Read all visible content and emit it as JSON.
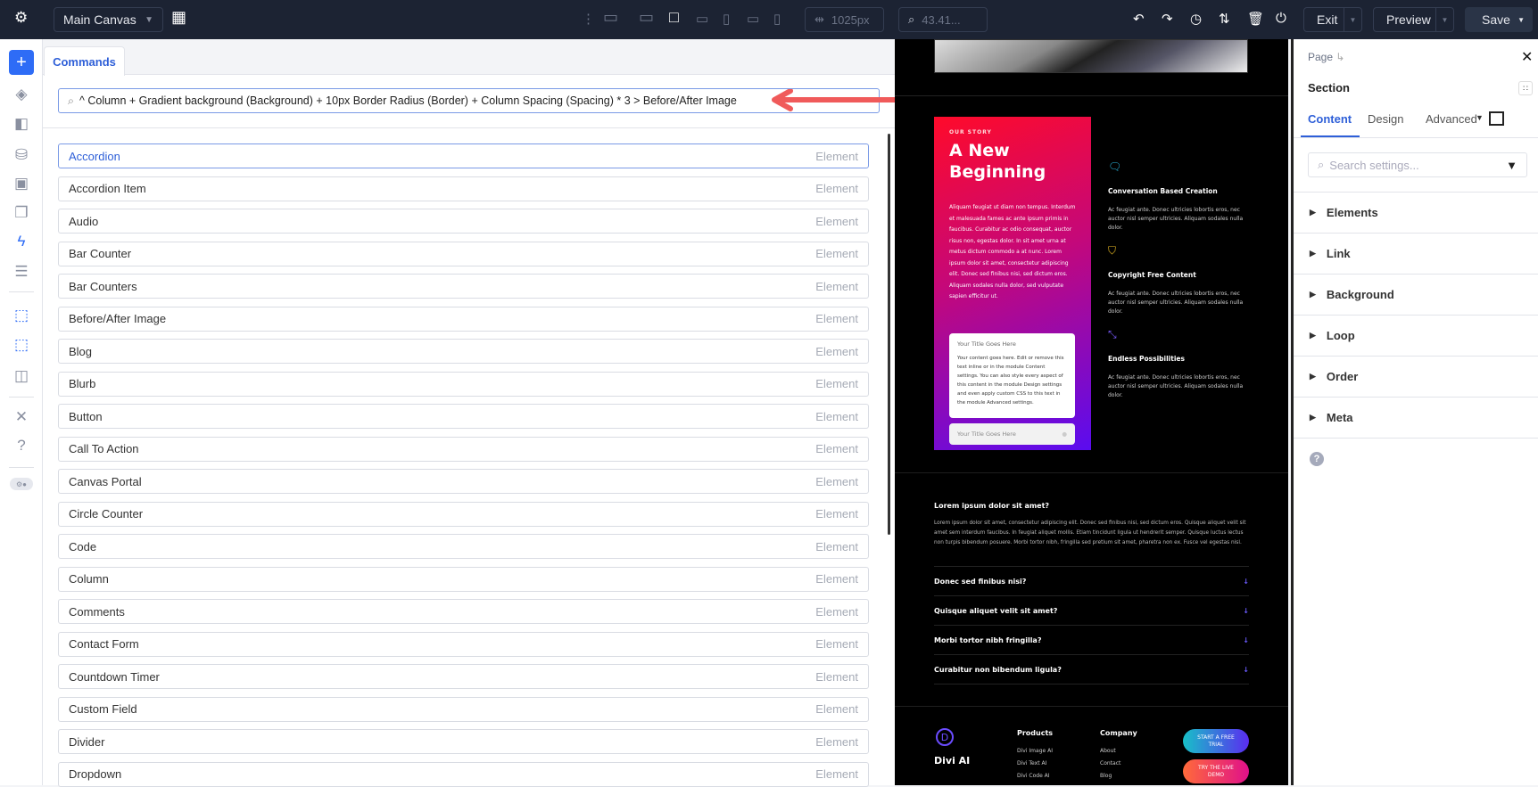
{
  "topbar": {
    "canvas_select": "Main Canvas",
    "width_value": "1025px",
    "zoom_value": "43.41...",
    "exit": "Exit",
    "preview": "Preview",
    "save": "Save"
  },
  "commands": {
    "tab": "Commands",
    "search_value": "^ Column + Gradient background (Background) + 10px Border Radius (Border) + Column Spacing (Spacing) * 3 > Before/After Image",
    "items": [
      {
        "label": "Accordion",
        "type": "Element"
      },
      {
        "label": "Accordion Item",
        "type": "Element"
      },
      {
        "label": "Audio",
        "type": "Element"
      },
      {
        "label": "Bar Counter",
        "type": "Element"
      },
      {
        "label": "Bar Counters",
        "type": "Element"
      },
      {
        "label": "Before/After Image",
        "type": "Element"
      },
      {
        "label": "Blog",
        "type": "Element"
      },
      {
        "label": "Blurb",
        "type": "Element"
      },
      {
        "label": "Button",
        "type": "Element"
      },
      {
        "label": "Call To Action",
        "type": "Element"
      },
      {
        "label": "Canvas Portal",
        "type": "Element"
      },
      {
        "label": "Circle Counter",
        "type": "Element"
      },
      {
        "label": "Code",
        "type": "Element"
      },
      {
        "label": "Column",
        "type": "Element"
      },
      {
        "label": "Comments",
        "type": "Element"
      },
      {
        "label": "Contact Form",
        "type": "Element"
      },
      {
        "label": "Countdown Timer",
        "type": "Element"
      },
      {
        "label": "Custom Field",
        "type": "Element"
      },
      {
        "label": "Divider",
        "type": "Element"
      },
      {
        "label": "Dropdown",
        "type": "Element"
      }
    ]
  },
  "preview": {
    "eyebrow": "OUR STORY",
    "heading1": "A New",
    "heading2": "Beginning",
    "story": "Aliquam feugiat ut diam non tempus. Interdum et malesuada fames ac ante ipsum primis in faucibus. Curabitur ac odio consequat, auctor risus non, egestas dolor. In sit amet urna at metus dictum commodo a at nunc. Lorem ipsum dolor sit amet, consectetur adipiscing elit. Donec sed finibus nisi, sed dictum eros. Aliquam sodales nulla dolor, sed vulputate sapien efficitur ut.",
    "toggle_title": "Your Title Goes Here",
    "toggle_body": "Your content goes here. Edit or remove this text inline or in the module Content settings. You can also style every aspect of this content in the module Design settings and even apply custom CSS to this text in the module Advanced settings.",
    "toggle2_title": "Your Title Goes Here",
    "features": [
      {
        "title": "Conversation Based Creation",
        "text": "Ac feugiat ante. Donec ultricies lobortis eros, nec auctor nisl semper ultricies. Aliquam sodales nulla dolor.",
        "color": "#2bb8e0"
      },
      {
        "title": "Copyright Free Content",
        "text": "Ac feugiat ante. Donec ultricies lobortis eros, nec auctor nisl semper ultricies. Aliquam sodales nulla dolor.",
        "color": "#e8b923"
      },
      {
        "title": "Endless Possibilities",
        "text": "Ac feugiat ante. Donec ultricies lobortis eros, nec auctor nisl semper ultricies. Aliquam sodales nulla dolor.",
        "color": "#7a5cff"
      }
    ],
    "faq_open_title": "Lorem ipsum dolor sit amet?",
    "faq_open_text": "Lorem ipsum dolor sit amet, consectetur adipiscing elit. Donec sed finibus nisi, sed dictum eros. Quisque aliquet velit sit amet sem interdum faucibus. In feugiat aliquet mollis. Etiam tincidunt ligula ut hendrerit semper. Quisque luctus lectus non turpis bibendum posuere. Morbi tortor nibh, fringilla sed pretium sit amet, pharetra non ex. Fusce vel egestas nisl.",
    "faqs": [
      "Donec sed finibus nisi?",
      "Quisque aliquet velit sit amet?",
      "Morbi tortor nibh fringilla?",
      "Curabitur non bibendum ligula?"
    ],
    "footer": {
      "logo_letter": "D",
      "brand": "Divi AI",
      "products_title": "Products",
      "products": [
        "Divi Image AI",
        "Divi Text AI",
        "Divi Code AI"
      ],
      "company_title": "Company",
      "company": [
        "About",
        "Contact",
        "Blog"
      ],
      "cta1": "START A FREE TRIAL",
      "cta2": "TRY THE LIVE DEMO"
    }
  },
  "settings": {
    "breadcrumb": "Page",
    "title": "Section",
    "tabs": [
      "Content",
      "Design",
      "Advanced"
    ],
    "active_tab": "Content",
    "search_placeholder": "Search settings...",
    "groups": [
      "Elements",
      "Link",
      "Background",
      "Loop",
      "Order",
      "Meta"
    ]
  },
  "colors": {
    "accent": "#2e5fd8",
    "topbar": "#1c2333",
    "annotation_arrow": "#f05a5a"
  }
}
